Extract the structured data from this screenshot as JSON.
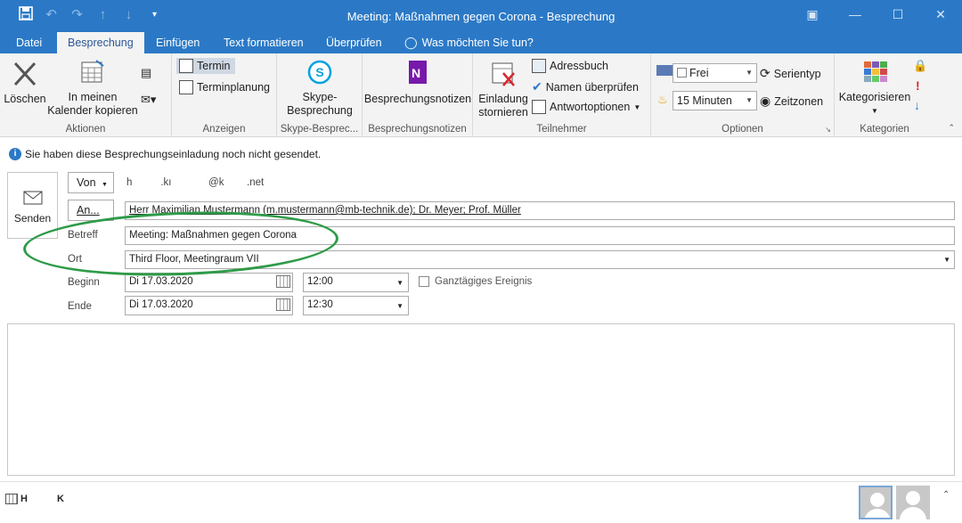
{
  "window": {
    "title": "Meeting: Maßnahmen gegen Corona  -  Besprechung",
    "qat": [
      "save-icon",
      "undo-icon",
      "redo-icon",
      "up-arrow-icon",
      "down-arrow-icon",
      "customize-icon"
    ],
    "controls": [
      "ribbon-display-icon",
      "minimize-icon",
      "maximize-icon",
      "close-icon"
    ]
  },
  "tabs": [
    "Datei",
    "Besprechung",
    "Einfügen",
    "Text formatieren",
    "Überprüfen"
  ],
  "tell_me": "Was möchten Sie tun?",
  "ribbon": {
    "aktionen": {
      "label": "Aktionen",
      "delete": "Löschen",
      "copy_line1": "In meinen",
      "copy_line2": "Kalender kopieren"
    },
    "anzeigen": {
      "label": "Anzeigen",
      "termin": "Termin",
      "terminplanung": "Terminplanung"
    },
    "skype": {
      "label": "Skype-Bespreс...",
      "line1": "Skype-",
      "line2": "Besprechung"
    },
    "notizen": {
      "label": "Besprechungsnotizen",
      "button": "Besprechungsnotizen"
    },
    "teilnehmer": {
      "label": "Teilnehmer",
      "cancel_line1": "Einladung",
      "cancel_line2": "stornieren",
      "adressbuch": "Adressbuch",
      "namen": "Namen überprüfen",
      "antwort": "Antwortoptionen"
    },
    "optionen": {
      "label": "Optionen",
      "status": "Frei",
      "reminder": "15 Minuten",
      "serientyp": "Serientyp",
      "zeitzonen": "Zeitzonen"
    },
    "kategorien": {
      "label": "Kategorien",
      "button": "Kategorisieren"
    }
  },
  "info": "Sie haben diese Besprechungseinladung noch nicht gesendet.",
  "form": {
    "send": "Senden",
    "von_button": "Von",
    "von_value": "h          .kı             @k        .net",
    "an_button": "An...",
    "an_value": "Herr Maximilian Mustermann (m.mustermann@mb-technik.de); Dr. Meyer; Prof. Müller",
    "betreff_label": "Betreff",
    "betreff_value": "Meeting: Maßnahmen gegen Corona",
    "ort_label": "Ort",
    "ort_value": "Third Floor, Meetingraum VII",
    "beginn_label": "Beginn",
    "beginn_date": "Di 17.03.2020",
    "beginn_time": "12:00",
    "allday": "Ganztägiges Ereignis",
    "ende_label": "Ende",
    "ende_date": "Di 17.03.2020",
    "ende_time": "12:30"
  },
  "status": {
    "item1": "H",
    "item2": "K"
  }
}
